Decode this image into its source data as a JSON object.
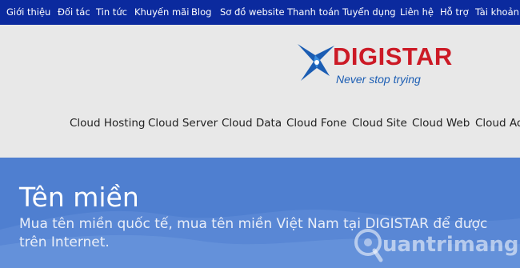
{
  "topnav": {
    "items": [
      "Giới thiệu",
      "Đối tác",
      "Tin tức",
      "Khuyến mãi",
      "Blog",
      "Sơ đồ website",
      "Thanh toán",
      "Tuyển dụng",
      "Liên hệ",
      "Hỗ trợ",
      "Tài khoản k"
    ]
  },
  "logo": {
    "name": "DIGISTAR",
    "tagline": "Never stop trying",
    "brand_color": "#cc1a26",
    "tagline_color": "#1b5db3"
  },
  "menu": {
    "items": [
      "Cloud Hosting",
      "Cloud Server",
      "Cloud Data",
      "Cloud Fone",
      "Cloud Site",
      "Cloud Web",
      "Cloud Ad"
    ]
  },
  "hero": {
    "title": "Tên miền",
    "description": "Mua tên miền quốc tế, mua tên miền Việt Nam tại DIGISTAR để được trên Internet.",
    "bg_color": "#4f7fd0"
  },
  "watermark": {
    "text": "uantrimang",
    "icon": "lightbulb-q-icon"
  },
  "colors": {
    "topbar": "#0b2a9e",
    "header_bg": "#e8e8e8"
  }
}
